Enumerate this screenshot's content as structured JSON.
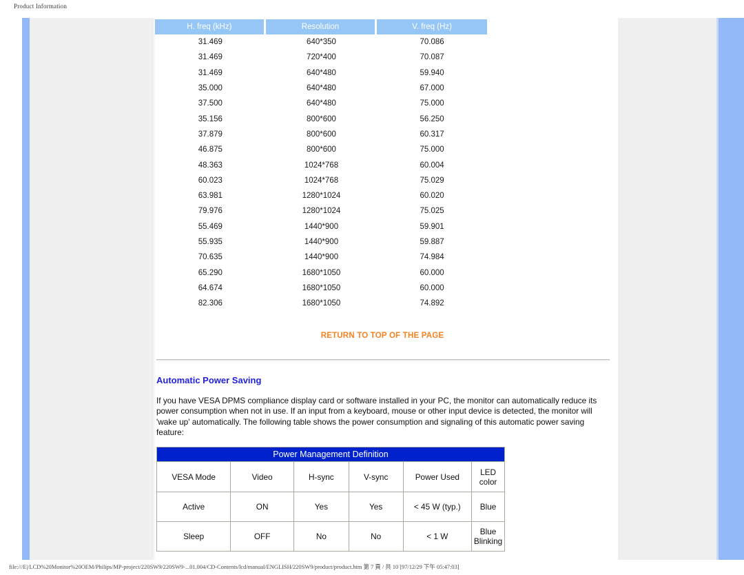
{
  "print_header": "Product Information",
  "timing_table": {
    "headers": [
      "H. freq (kHz)",
      "Resolution",
      "V. freq (Hz)"
    ],
    "rows": [
      [
        "31.469",
        "640*350",
        "70.086"
      ],
      [
        "31.469",
        "720*400",
        "70.087"
      ],
      [
        "31.469",
        "640*480",
        "59.940"
      ],
      [
        "35.000",
        "640*480",
        "67.000"
      ],
      [
        "37.500",
        "640*480",
        "75.000"
      ],
      [
        "35.156",
        "800*600",
        "56.250"
      ],
      [
        "37.879",
        "800*600",
        "60.317"
      ],
      [
        "46.875",
        "800*600",
        "75.000"
      ],
      [
        "48.363",
        "1024*768",
        "60.004"
      ],
      [
        "60.023",
        "1024*768",
        "75.029"
      ],
      [
        "63.981",
        "1280*1024",
        "60.020"
      ],
      [
        "79.976",
        "1280*1024",
        "75.025"
      ],
      [
        "55.469",
        "1440*900",
        "59.901"
      ],
      [
        "55.935",
        "1440*900",
        "59.887"
      ],
      [
        "70.635",
        "1440*900",
        "74.984"
      ],
      [
        "65.290",
        "1680*1050",
        "60.000"
      ],
      [
        "64.674",
        "1680*1050",
        "60.000"
      ],
      [
        "82.306",
        "1680*1050",
        "74.892"
      ]
    ]
  },
  "return_to_top": "RETURN TO TOP OF THE PAGE",
  "section": {
    "heading": "Automatic Power Saving",
    "paragraph": "If you have VESA DPMS compliance display card or software installed in your PC, the monitor can automatically reduce its power consumption when not in use. If an input from a keyboard, mouse or other input device is detected, the monitor will 'wake up' automatically. The following table shows the power consumption and signaling of this automatic power saving feature:"
  },
  "power_table": {
    "title": "Power Management Definition",
    "headers": [
      "VESA Mode",
      "Video",
      "H-sync",
      "V-sync",
      "Power Used",
      "LED color"
    ],
    "header_led_line1": "LED",
    "header_led_line2": "color",
    "rows": [
      {
        "mode": "Active",
        "video": "ON",
        "hsync": "Yes",
        "vsync": "Yes",
        "power": "< 45 W (typ.)",
        "led_line1": "Blue",
        "led_line2": ""
      },
      {
        "mode": "Sleep",
        "video": "OFF",
        "hsync": "No",
        "vsync": "No",
        "power": "< 1 W",
        "led_line1": "Blue",
        "led_line2": "Blinking"
      }
    ]
  },
  "status_bar": {
    "text": "file:///E|/LCD%20Monitor%20OEM/Philips/MP-project/220SW9/220SW9-...01.004/CD-Contents/lcd/manual/ENGLISH/220SW9/product/product.htm 第 7 頁 / 共 10 [97/12/29 下午 05:47:03]"
  },
  "colors": {
    "header_blue": "#95c6f5",
    "nav_blue": "#93b8f7",
    "panel_gray": "#efefef",
    "link_orange": "#f58220",
    "heading_blue": "#2222dd",
    "title_blue": "#0022cc"
  }
}
